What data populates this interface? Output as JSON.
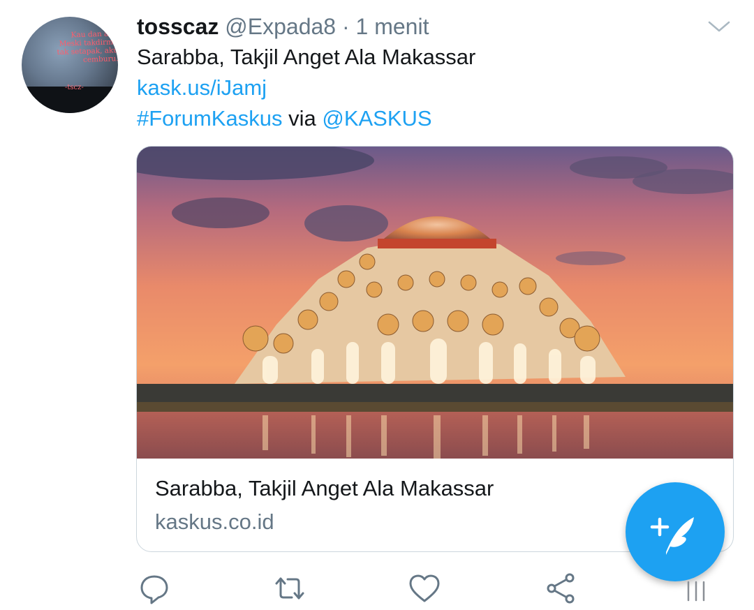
{
  "tweet": {
    "display_name": "tosscaz",
    "handle": "@Expada8",
    "separator": "·",
    "time": "1 menit",
    "text": "Sarabba, Takjil Anget Ala Makassar",
    "short_link": "kask.us/iJamj",
    "hashtag": "#ForumKaskus",
    "via_word": "via",
    "mention": "@KASKUS"
  },
  "avatar": {
    "quote_text": "Kau dan aku\nMeski takdirmu\ntak setapak, aku\ncemburu.",
    "signature": "-tscz-"
  },
  "card": {
    "title": "Sarabba, Takjil Anget Ala Makassar",
    "domain": "kaskus.co.id",
    "image_subject": "floating-mosque-at-sunset"
  },
  "actions": [
    "reply-icon",
    "retweet-icon",
    "like-icon",
    "share-icon"
  ],
  "fab": {
    "icon": "compose-tweet-icon"
  },
  "colors": {
    "accent": "#1da1f2",
    "text_primary": "#14171a",
    "text_secondary": "#657786",
    "border": "#ccd6dd"
  }
}
